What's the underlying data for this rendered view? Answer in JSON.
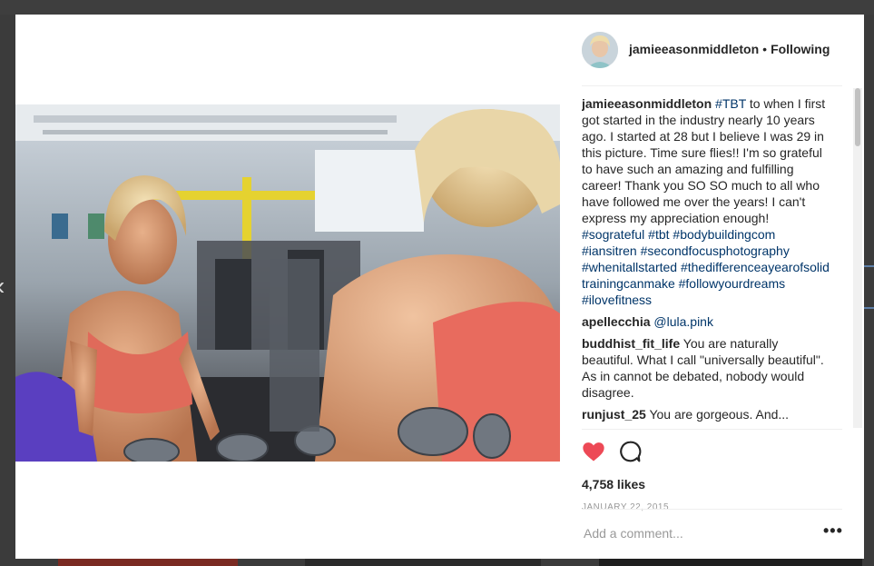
{
  "post": {
    "username": "jamieeasonmiddleton",
    "separator": "•",
    "follow_status": "Following",
    "likes": "4,758 likes",
    "date": "JANUARY 22, 2015",
    "comment_placeholder": "Add a comment...",
    "more_label": "•••"
  },
  "caption": {
    "user": "jamieeasonmiddleton",
    "tag_tbt": "#TBT",
    "text": "to when I first got started in the industry nearly 10 years ago. I started at 28 but I believe I was 29 in this picture. Time sure flies!! I'm so grateful to have such an amazing and fulfilling career! Thank you SO SO much to all who have followed me over the years! I can't express my appreciation enough!",
    "tags": [
      "#sograteful",
      "#tbt",
      "#bodybuildingcom",
      "#iansitren",
      "#secondfocusphotography",
      "#whenitallstarted",
      "#thedifferenceayearofsolidtrainingcanmake",
      "#followyourdreams",
      "#ilovefitness"
    ]
  },
  "comments": [
    {
      "user": "apellecchia",
      "text": "@lula.pink"
    },
    {
      "user": "buddhist_fit_life",
      "text": "You are naturally beautiful. What I call \"universally beautiful\". As in cannot be debated, nobody would disagree."
    },
    {
      "user": "runjust_25",
      "text": "You are gorgeous. And..."
    }
  ],
  "colors": {
    "like_heart": "#ed4956",
    "hashtag": "#003569",
    "text": "#262626",
    "muted": "#999999"
  },
  "icons": {
    "like": "heart-icon",
    "comment": "comment-bubble-icon",
    "prev": "chevron-left-icon",
    "more": "ellipsis-icon"
  }
}
